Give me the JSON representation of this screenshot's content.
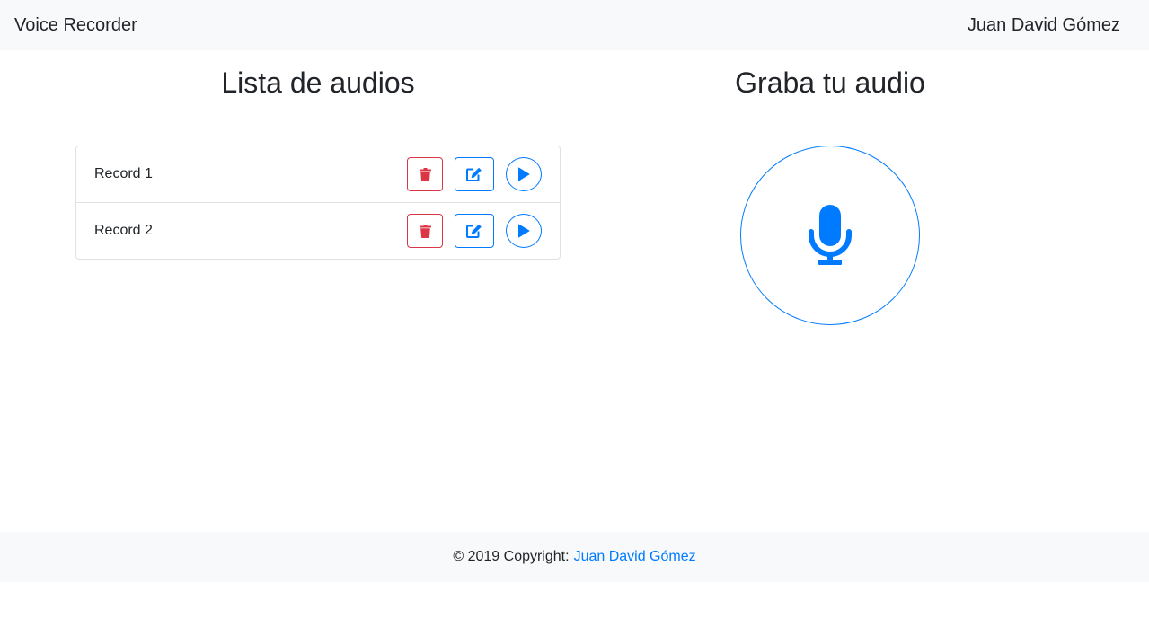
{
  "navbar": {
    "brand": "Voice Recorder",
    "user": "Juan David Gómez"
  },
  "list_section": {
    "title": "Lista de audios",
    "items": [
      {
        "name": "Record 1"
      },
      {
        "name": "Record 2"
      }
    ]
  },
  "record_section": {
    "title": "Graba tu audio"
  },
  "footer": {
    "copyright": "© 2019 Copyright:",
    "author_link": "Juan David Gómez"
  },
  "icons": {
    "delete": "trash-icon",
    "edit": "edit-icon",
    "play": "play-icon",
    "record": "microphone-icon"
  },
  "colors": {
    "primary": "#007bff",
    "danger": "#dc3545",
    "navbar_bg": "#f8f9fa"
  }
}
